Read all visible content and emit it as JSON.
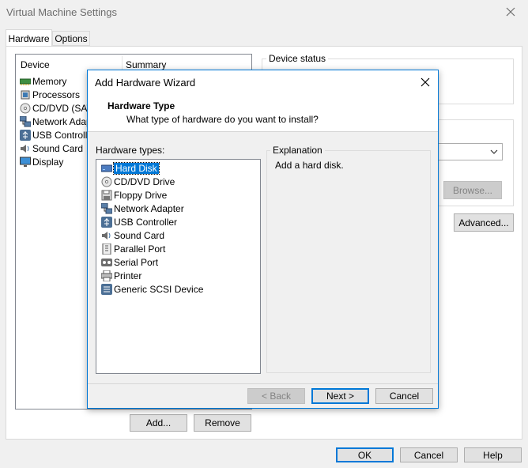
{
  "window": {
    "title": "Virtual Machine Settings"
  },
  "tabs": [
    {
      "label": "Hardware"
    },
    {
      "label": "Options"
    }
  ],
  "device_table": {
    "headers": {
      "device": "Device",
      "summary": "Summary"
    },
    "rows": [
      {
        "label": "Memory",
        "icon": "memory-icon"
      },
      {
        "label": "Processors",
        "icon": "processor-icon"
      },
      {
        "label": "CD/DVD (SATA",
        "icon": "cd-dvd-icon"
      },
      {
        "label": "Network Adap",
        "icon": "network-adapter-icon"
      },
      {
        "label": "USB Controller",
        "icon": "usb-icon"
      },
      {
        "label": "Sound Card",
        "icon": "sound-card-icon"
      },
      {
        "label": "Display",
        "icon": "display-icon"
      }
    ]
  },
  "right_panel": {
    "device_status_label": "Device status",
    "browse_label": "Browse...",
    "advanced_label": "Advanced..."
  },
  "bottom_buttons": {
    "add": "Add...",
    "remove": "Remove",
    "ok": "OK",
    "cancel": "Cancel",
    "help": "Help"
  },
  "wizard": {
    "title": "Add Hardware Wizard",
    "heading": "Hardware Type",
    "subheading": "What type of hardware do you want to install?",
    "list_label": "Hardware types:",
    "items": [
      {
        "label": "Hard Disk",
        "icon": "hard-disk-icon",
        "selected": true
      },
      {
        "label": "CD/DVD Drive",
        "icon": "cd-dvd-icon"
      },
      {
        "label": "Floppy Drive",
        "icon": "floppy-icon"
      },
      {
        "label": "Network Adapter",
        "icon": "network-adapter-icon"
      },
      {
        "label": "USB Controller",
        "icon": "usb-icon"
      },
      {
        "label": "Sound Card",
        "icon": "sound-card-icon"
      },
      {
        "label": "Parallel Port",
        "icon": "parallel-port-icon"
      },
      {
        "label": "Serial Port",
        "icon": "serial-port-icon"
      },
      {
        "label": "Printer",
        "icon": "printer-icon"
      },
      {
        "label": "Generic SCSI Device",
        "icon": "scsi-icon"
      }
    ],
    "explanation_label": "Explanation",
    "explanation_text": "Add a hard disk.",
    "back_label": "< Back",
    "next_label": "Next >",
    "cancel_label": "Cancel"
  },
  "colors": {
    "accent": "#0078d7",
    "dialog_bg": "#f0f0f0",
    "selection": "#0078d7"
  }
}
